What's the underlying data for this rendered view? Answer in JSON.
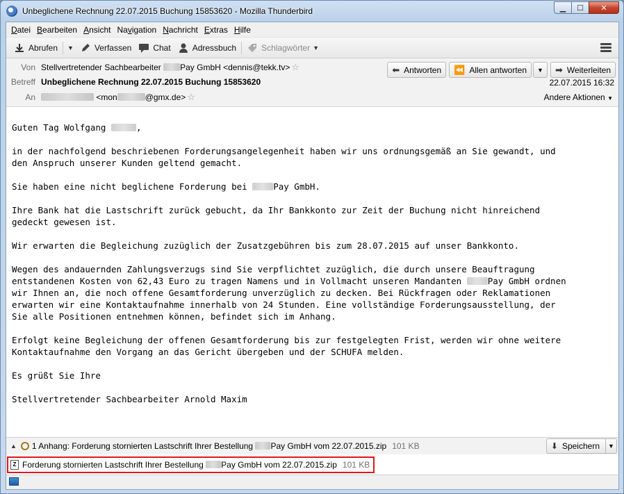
{
  "window": {
    "title": "Unbeglichene Rechnung 22.07.2015 Buchung 15853620 - Mozilla Thunderbird",
    "controls": {
      "minimize": "▁",
      "maximize": "☐",
      "close": "✕"
    }
  },
  "menubar": [
    {
      "pre": "",
      "u": "D",
      "post": "atei"
    },
    {
      "pre": "",
      "u": "B",
      "post": "earbeiten"
    },
    {
      "pre": "",
      "u": "A",
      "post": "nsicht"
    },
    {
      "pre": "Na",
      "u": "v",
      "post": "igation"
    },
    {
      "pre": "",
      "u": "N",
      "post": "achricht"
    },
    {
      "pre": "",
      "u": "E",
      "post": "xtras"
    },
    {
      "pre": "",
      "u": "H",
      "post": "ilfe"
    }
  ],
  "toolbar": {
    "fetch": "Abrufen",
    "compose": "Verfassen",
    "chat": "Chat",
    "addressbook": "Adressbuch",
    "tags": "Schlagwörter"
  },
  "header": {
    "from_label": "Von",
    "from_name_pre": "Stellvertretender Sachbearbeiter",
    "from_name_post": "Pay GmbH <dennis@tekk.tv>",
    "subject_label": "Betreff",
    "subject": "Unbeglichene Rechnung 22.07.2015 Buchung 15853620",
    "to_label": "An",
    "to_addr_pre": "<mon",
    "to_addr_post": "@gmx.de>",
    "date": "22.07.2015 16:32",
    "other_actions": "Andere Aktionen",
    "reply": "Antworten",
    "reply_all": "Allen antworten",
    "forward": "Weiterleiten"
  },
  "body": {
    "greeting": "Guten Tag Wolfgang",
    "greeting_end": ",",
    "p1": "in der nachfolgend beschriebenen Forderungsangelegenheit haben wir uns ordnungsgemäß an Sie gewandt, und\nden Anspruch unserer Kunden geltend gemacht.",
    "p2_pre": "Sie haben eine nicht beglichene Forderung bei ",
    "p2_post": "Pay GmbH.",
    "p3": "Ihre Bank hat die Lastschrift zurück gebucht, da Ihr Bankkonto zur Zeit der Buchung nicht hinreichend\ngedeckt gewesen ist.",
    "p4": "Wir erwarten die Begleichung zuzüglich der Zusatzgebühren bis zum 28.07.2015 auf unser Bankkonto.",
    "p5_pre": "Wegen des andauernden Zahlungsverzugs sind Sie verpflichtet zuzüglich, die durch unsere Beauftragung\nentstandenen Kosten von 62,43 Euro zu tragen Namens und in Vollmacht unseren Mandanten ",
    "p5_post": "Pay GmbH ordnen\nwir Ihnen an, die noch offene Gesamtforderung unverzüglich zu decken. Bei Rückfragen oder Reklamationen\nerwarten wir eine Kontaktaufnahme innerhalb von 24 Stunden. Eine vollständige Forderungsausstellung, der\nSie alle Positionen entnehmen können, befindet sich im Anhang.",
    "p6": "Erfolgt keine Begleichung der offenen Gesamtforderung bis zur festgelegten Frist, werden wir ohne weitere\nKontaktaufnahme den Vorgang an das Gericht übergeben und der SCHUFA melden.",
    "p7": "Es grüßt Sie Ihre",
    "p8": "Stellvertretender Sachbearbeiter Arnold Maxim"
  },
  "attachments": {
    "summary_pre": "1 Anhang: Forderung stornierten Lastschrift Ihrer Bestellung ",
    "summary_post": "Pay GmbH vom 22.07.2015.zip",
    "summary_size": "101 KB",
    "save": "Speichern",
    "item_pre": "Forderung stornierten Lastschrift Ihrer Bestellung ",
    "item_post": "Pay GmbH vom 22.07.2015.zip",
    "item_size": "101 KB",
    "highlight_color": "#e0161b"
  }
}
